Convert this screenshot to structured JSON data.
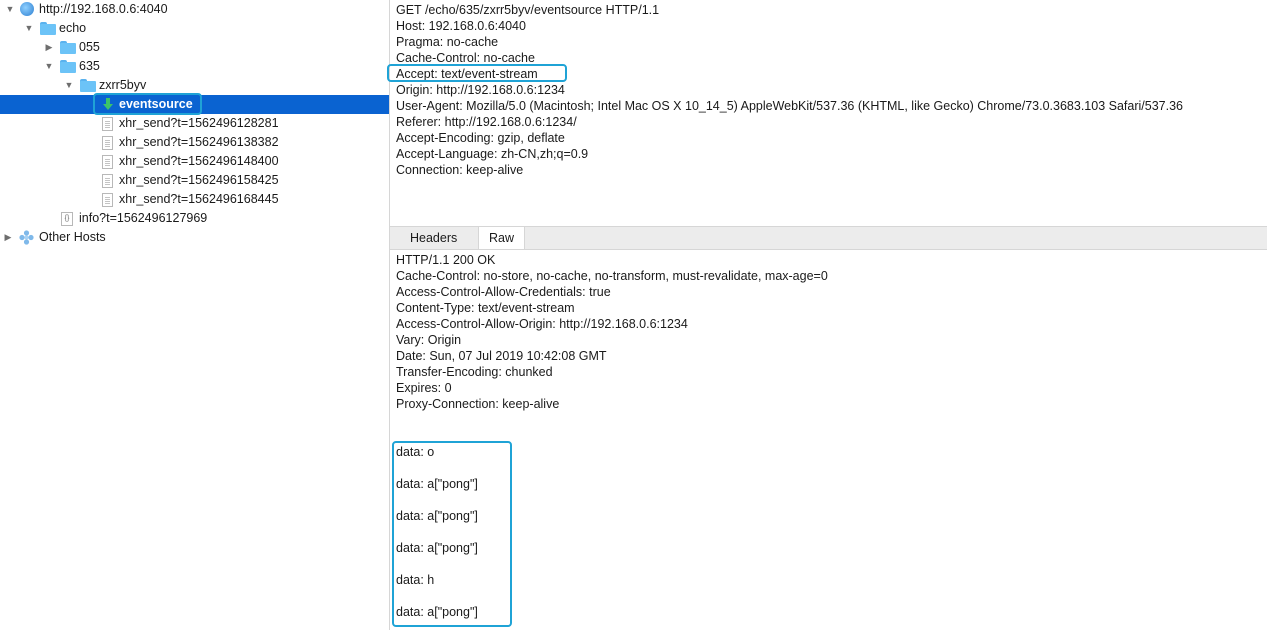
{
  "tree": {
    "host": "http://192.168.0.6:4040",
    "echo": "echo",
    "folder_055": "055",
    "folder_635": "635",
    "folder_session": "zxrr5byv",
    "selected_item": "eventsource",
    "xhr_items": [
      "xhr_send?t=1562496128281",
      "xhr_send?t=1562496138382",
      "xhr_send?t=1562496148400",
      "xhr_send?t=1562496158425",
      "xhr_send?t=1562496168445"
    ],
    "info_item": "info?t=1562496127969",
    "other_hosts": "Other Hosts"
  },
  "request": {
    "lines": [
      "GET /echo/635/zxrr5byv/eventsource HTTP/1.1",
      "Host: 192.168.0.6:4040",
      "Pragma: no-cache",
      "Cache-Control: no-cache",
      "Accept: text/event-stream",
      "Origin: http://192.168.0.6:1234",
      "User-Agent: Mozilla/5.0 (Macintosh; Intel Mac OS X 10_14_5) AppleWebKit/537.36 (KHTML, like Gecko) Chrome/73.0.3683.103 Safari/537.36",
      "Referer: http://192.168.0.6:1234/",
      "Accept-Encoding: gzip, deflate",
      "Accept-Language: zh-CN,zh;q=0.9",
      "Connection: keep-alive"
    ]
  },
  "tabs": {
    "headers": "Headers",
    "raw": "Raw"
  },
  "response": {
    "lines": [
      "HTTP/1.1 200 OK",
      "Cache-Control: no-store, no-cache, no-transform, must-revalidate, max-age=0",
      "Access-Control-Allow-Credentials: true",
      "Content-Type: text/event-stream",
      "Access-Control-Allow-Origin: http://192.168.0.6:1234",
      "Vary: Origin",
      "Date: Sun, 07 Jul 2019 10:42:08 GMT",
      "Transfer-Encoding: chunked",
      "Expires: 0",
      "Proxy-Connection: keep-alive"
    ],
    "events": [
      "data: o",
      "data: a[\"pong\"]",
      "data: a[\"pong\"]",
      "data: a[\"pong\"]",
      "data: h",
      "data: a[\"pong\"]"
    ]
  },
  "colors": {
    "selection": "#0a63d1",
    "highlight": "#1fa3d6",
    "folder": "#6cc3f7"
  }
}
